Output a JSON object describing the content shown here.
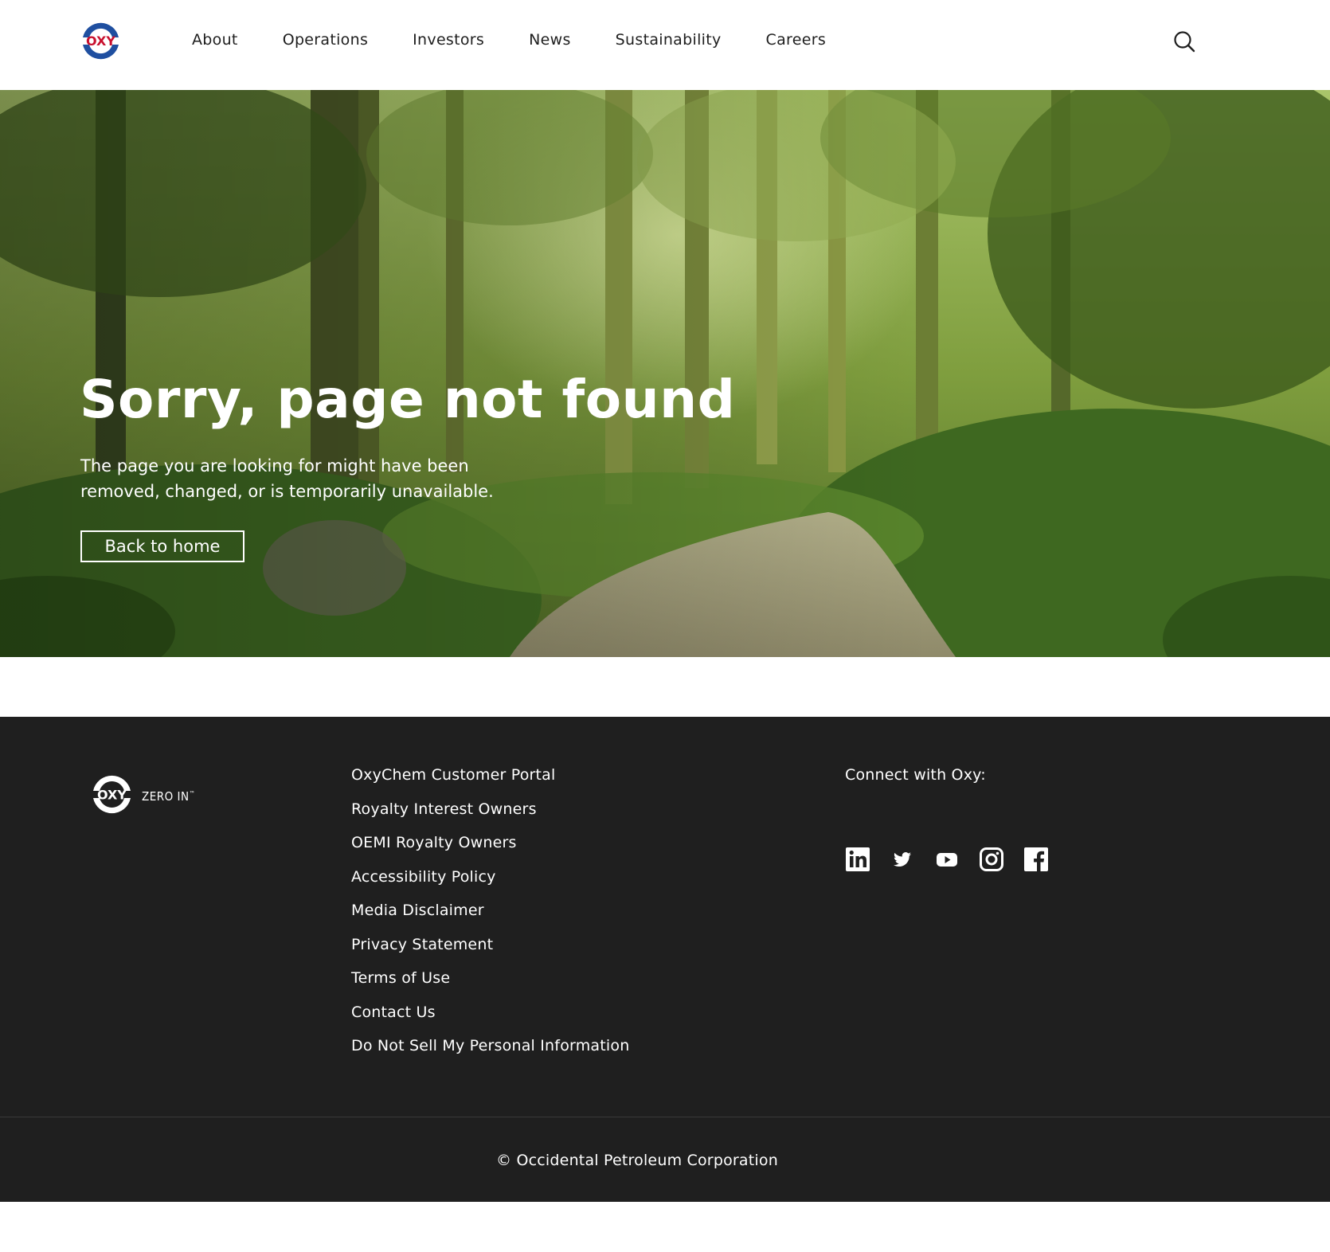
{
  "brand": {
    "logo_text": "OXY",
    "tagline": "ZERO IN",
    "tagline_mark": "™",
    "logo_colors": {
      "red": "#c8102e",
      "blue": "#1f4fa0"
    }
  },
  "nav": {
    "items": [
      {
        "label": "About"
      },
      {
        "label": "Operations"
      },
      {
        "label": "Investors"
      },
      {
        "label": "News"
      },
      {
        "label": "Sustainability"
      },
      {
        "label": "Careers"
      }
    ],
    "search_icon": "search-icon"
  },
  "hero": {
    "title": "Sorry, page not found",
    "text": "The page you are looking for might have been removed, changed, or is temporarily unavailable.",
    "button_label": "Back to home",
    "background": "forest path photo"
  },
  "footer": {
    "links": [
      {
        "label": "OxyChem Customer Portal"
      },
      {
        "label": "Royalty Interest Owners"
      },
      {
        "label": "OEMI Royalty Owners"
      },
      {
        "label": "Accessibility Policy"
      },
      {
        "label": "Media Disclaimer"
      },
      {
        "label": "Privacy Statement"
      },
      {
        "label": "Terms of Use"
      },
      {
        "label": "Contact Us"
      },
      {
        "label": "Do Not Sell My Personal Information"
      }
    ],
    "connect_label": "Connect with Oxy:",
    "social_icons": [
      "linkedin-icon",
      "twitter-icon",
      "youtube-icon",
      "instagram-icon",
      "facebook-icon"
    ],
    "copyright": "© Occidental Petroleum Corporation",
    "background_color": "#1f1f1f"
  }
}
